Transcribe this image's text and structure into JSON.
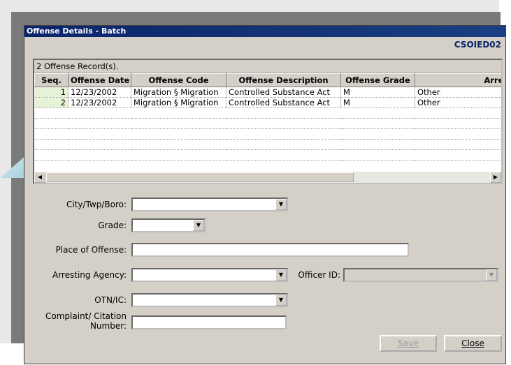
{
  "window": {
    "title": "Offense Details - Batch",
    "form_code": "CSOIED02"
  },
  "grid": {
    "caption": "2 Offense Record(s).",
    "columns": [
      "Seq.",
      "Offense Date",
      "Offense Code",
      "Offense Description",
      "Offense Grade",
      "Arresting A"
    ],
    "rows": [
      [
        "1",
        "12/23/2002",
        "Migration § Migration",
        "Controlled Substance Act",
        "M",
        "Other"
      ],
      [
        "2",
        "12/23/2002",
        "Migration § Migration",
        "Controlled Substance Act",
        "M",
        "Other"
      ]
    ]
  },
  "form": {
    "city_label": "City/Twp/Boro:",
    "grade_label": "Grade:",
    "place_label": "Place of Offense:",
    "agency_label": "Arresting Agency:",
    "officer_label": "Officer ID:",
    "otn_label": "OTN/IC:",
    "complaint_label_line1": "Complaint/ Citation",
    "complaint_label_line2": "Number:"
  },
  "buttons": {
    "save": "Save",
    "close": "Close"
  },
  "colors": {
    "titlebar": "#0a246a",
    "form_code": "#0a246a",
    "seq_highlight": "#e6f3d6"
  }
}
